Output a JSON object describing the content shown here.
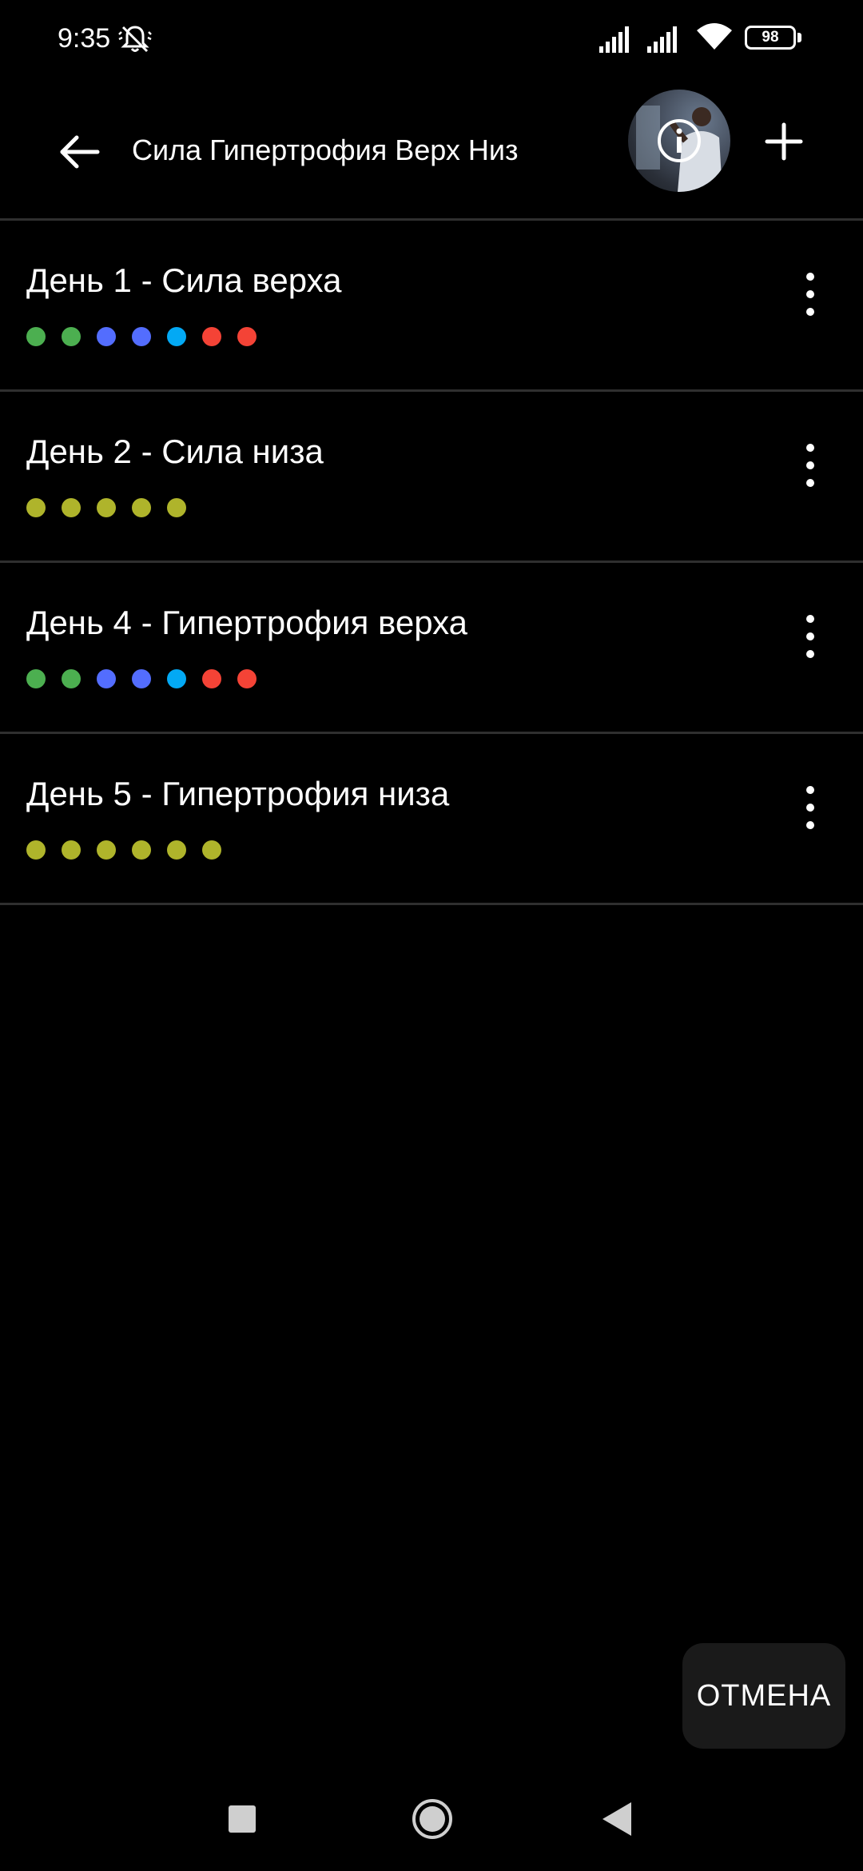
{
  "status_bar": {
    "time": "9:35",
    "battery": "98"
  },
  "app_bar": {
    "title": "Сила Гипертрофия Верх Низ",
    "icons": [
      "back-arrow-icon",
      "avatar",
      "info-icon",
      "plus-icon"
    ]
  },
  "colors": {
    "green": "#4caf50",
    "indigo": "#536dfe",
    "lightblue": "#03a9f4",
    "red": "#f44336",
    "lime": "#afb42b",
    "divider": "#2f2f2f",
    "cancel_bg": "#1a1a1a"
  },
  "days": [
    {
      "title": "День 1 - Сила верха",
      "dots": [
        "#4caf50",
        "#4caf50",
        "#536dfe",
        "#536dfe",
        "#03a9f4",
        "#f44336",
        "#f44336"
      ]
    },
    {
      "title": "День 2 - Сила низа",
      "dots": [
        "#afb42b",
        "#afb42b",
        "#afb42b",
        "#afb42b",
        "#afb42b"
      ]
    },
    {
      "title": "День 4 - Гипертрофия верха",
      "dots": [
        "#4caf50",
        "#4caf50",
        "#536dfe",
        "#536dfe",
        "#03a9f4",
        "#f44336",
        "#f44336"
      ]
    },
    {
      "title": "День 5 - Гипертрофия низа",
      "dots": [
        "#afb42b",
        "#afb42b",
        "#afb42b",
        "#afb42b",
        "#afb42b",
        "#afb42b"
      ]
    }
  ],
  "cancel_label": "ОТМЕНА",
  "nav": [
    "recents-icon",
    "home-icon",
    "back-icon"
  ]
}
